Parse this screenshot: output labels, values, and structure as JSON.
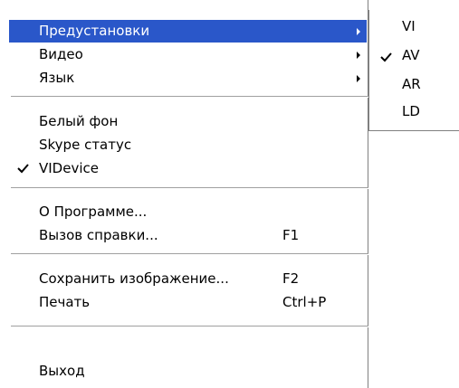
{
  "menu": {
    "items": [
      {
        "label": "Предустановки",
        "submenu": true,
        "highlighted": true
      },
      {
        "label": "Видео",
        "submenu": true
      },
      {
        "label": "Язык",
        "submenu": true
      },
      {
        "label": "Белый фон"
      },
      {
        "label": "Skype статус"
      },
      {
        "label": "VIDevice",
        "checked": true
      },
      {
        "label": "О Программе..."
      },
      {
        "label": "Вызов справки...",
        "shortcut": "F1"
      },
      {
        "label": "Сохранить изображение...",
        "shortcut": "F2"
      },
      {
        "label": "Печать",
        "shortcut": "Ctrl+P"
      },
      {
        "label": "Выход"
      }
    ]
  },
  "submenu": {
    "items": [
      {
        "label": "VI"
      },
      {
        "label": "AV",
        "checked": true
      },
      {
        "label": "AR"
      },
      {
        "label": "LD"
      }
    ]
  },
  "colors": {
    "highlight": "#2a57c9",
    "separator": "#a0a0a0"
  }
}
